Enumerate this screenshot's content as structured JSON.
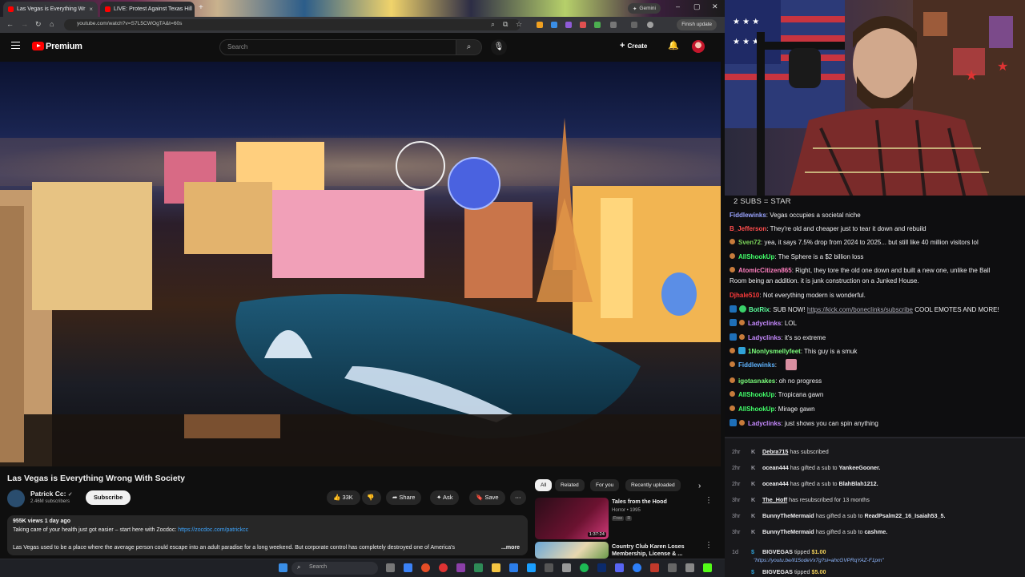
{
  "browser": {
    "tabs": [
      {
        "title": "Las Vegas is Everything Wr",
        "active": true
      },
      {
        "title": "LIVE: Protest Against Texas Hill",
        "active": false
      }
    ],
    "new_tab": "+",
    "gemini_label": "Gemini",
    "url": "youtube.com/watch?v=S7L5CWOgTA&t=60s",
    "finish_update": "Finish update"
  },
  "youtube": {
    "brand": "Premium",
    "search_placeholder": "Search",
    "create_label": "Create",
    "video": {
      "title": "Las Vegas is Everything Wrong With Society",
      "channel": "Patrick Cc:",
      "subscribers": "2.46M subscribers",
      "subscribe_label": "Subscribe",
      "likes": "33K",
      "share_label": "Share",
      "ask_label": "Ask",
      "save_label": "Save",
      "views_date": "955K views  1 day ago",
      "desc_line1": "Taking care of your health just got easier – start here with Zocdoc: ",
      "desc_link": "https://zocdoc.com/patrickcc",
      "desc_line2": "Las Vegas used to be a place where the average person could escape into an adult paradise for a long weekend. But corporate control has completely destroyed one of America's",
      "more_label": "...more"
    },
    "chips": [
      "All",
      "Related",
      "For you",
      "Recently uploaded"
    ],
    "related": [
      {
        "title": "Tales from the Hood",
        "meta": "Horror • 1995",
        "badge1": "Free",
        "badge2": "R",
        "duration": "1:37:24"
      },
      {
        "title": "Country Club Karen Loses Membership, License & ...",
        "meta": ""
      }
    ]
  },
  "taskbar": {
    "search_placeholder": "Search"
  },
  "stream": {
    "goal_text": "2 SUBS = STAR",
    "chat": [
      {
        "user": "Fiddlewinks",
        "text": " Vegas occupies a societal niche",
        "color": "#9aa4ff"
      },
      {
        "user": "B_Jefferson",
        "text": " They're old and cheaper just to tear it down and rebuild",
        "color": "#ff4d4d"
      },
      {
        "user": "Sven72",
        "text": " yea, it says 7.5% drop from 2024 to 2025... but still like 40 million visitors lol",
        "color": "#7bd35a"
      },
      {
        "user": "AllShookUp",
        "text": " The Sphere is a $2 billion loss",
        "color": "#42ff6a"
      },
      {
        "user": "AtomicCitizen865",
        "text": " Right, they tore the old one down and built a new one, unlike the Ball",
        "color": "#ff7fbf"
      },
      {
        "user": "",
        "text": "Room being an addition. it is junk construction on a Junked House.",
        "color": ""
      },
      {
        "user": "Djhale510",
        "text": " Not everything modern is wonderful.",
        "color": "#ff3b3b"
      },
      {
        "user": "BotRix",
        "text": " SUB NOW! ",
        "link": "https://kick.com/bonecIinks/subscribe",
        "tail": " COOL EMOTES AND MORE!",
        "color": "#5cff9d"
      },
      {
        "user": "Ladyclinks",
        "text": " LOL",
        "color": "#c68aff"
      },
      {
        "user": "Ladyclinks",
        "text": " it's so extreme",
        "color": "#c68aff"
      },
      {
        "user": "1Nonlysmellyfeet",
        "text": " This guy is a smuk",
        "color": "#7bff7b"
      },
      {
        "user": "Fiddlewinks",
        "text": " ",
        "color": "#5fb4ff"
      },
      {
        "user": "igotasnakes",
        "text": " oh no progress",
        "color": "#7bff7b"
      },
      {
        "user": "AllShookUp",
        "text": " Tropicana gawn",
        "color": "#42ff6a"
      },
      {
        "user": "AllShookUp",
        "text": " Mirage gawn",
        "color": "#42ff6a"
      },
      {
        "user": "Ladyclinks",
        "text": " just shows you can spin anything",
        "color": "#c68aff"
      }
    ],
    "events": [
      {
        "time": "2hr",
        "name": "Debra715",
        "text": " has subscribed",
        "target": ""
      },
      {
        "time": "2hr",
        "name": "ocean444",
        "text": " has gifted a sub to ",
        "target": "YankeeGooner."
      },
      {
        "time": "2hr",
        "name": "ocean444",
        "text": " has gifted a sub to ",
        "target": "BlahBlah1212."
      },
      {
        "time": "3hr",
        "name": "The_Hoff",
        "text": " has resubscribed for 13 months",
        "target": ""
      },
      {
        "time": "3hr",
        "name": "BunnyTheMermaid",
        "text": " has gifted a sub to ",
        "target": "ReadPsalm22_16_Isaiah53_5."
      },
      {
        "time": "3hr",
        "name": "BunnyTheMermaid",
        "text": " has gifted a sub to ",
        "target": "cashme."
      },
      {
        "time": "1d",
        "name": "BIGVEGAS",
        "text": " tipped ",
        "amount": "$1.00",
        "link": "\"https://youtu.be/lI15odeVx7g?si=ahcGVPRqYAZ-F1pm\""
      },
      {
        "time": "1d",
        "name": "BIGVEGAS",
        "text": " tipped ",
        "amount": "$5.00"
      }
    ]
  }
}
